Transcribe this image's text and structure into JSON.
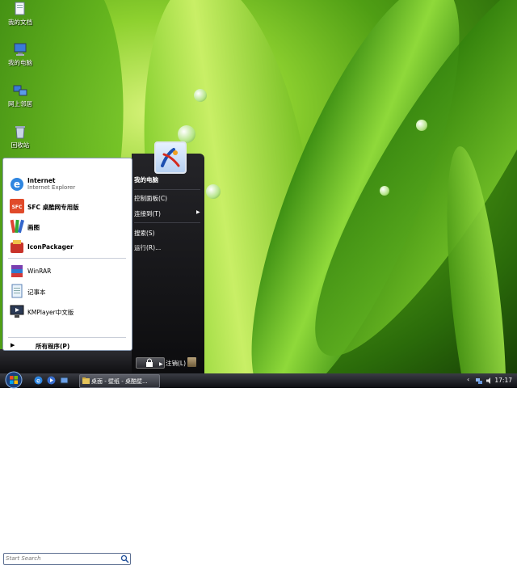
{
  "desktop": {
    "icons": [
      {
        "label": "我的文档",
        "icon": "documents-folder-icon"
      },
      {
        "label": "我的电脑",
        "icon": "computer-icon"
      },
      {
        "label": "网上邻居",
        "icon": "network-icon"
      },
      {
        "label": "回收站",
        "icon": "recycle-bin-icon"
      }
    ]
  },
  "start_menu": {
    "pinned": [
      {
        "title": "Internet",
        "subtitle": "Internet Explorer",
        "icon": "internet-explorer-icon"
      },
      {
        "title": "SFC 桌酷网专用版",
        "icon": "sfc-icon"
      }
    ],
    "recent_bold": [
      {
        "title": "画图",
        "icon": "paint-icon"
      },
      {
        "title": "IconPackager",
        "icon": "iconpackager-icon"
      }
    ],
    "recent": [
      {
        "title": "WinRAR",
        "icon": "winrar-icon"
      },
      {
        "title": "记事本",
        "icon": "notepad-icon"
      },
      {
        "title": "KMPlayer中文版",
        "icon": "kmplayer-icon"
      }
    ],
    "all_programs": "所有程序(P)",
    "search_placeholder": "Start Search",
    "right": {
      "user_title": "我的电脑",
      "control_panel": "控制面板(C)",
      "connect_to": "连接到(T)",
      "search": "搜索(S)",
      "run": "运行(R)..."
    },
    "logoff": "注销(L)"
  },
  "taskbar": {
    "task_button": "桌面 - 壁纸 - 桌酷壁...",
    "clock": "17:17",
    "tray_chevron": "‹"
  },
  "colors": {
    "accent": "#1f6fd0",
    "menu_dark": "#18191d"
  }
}
